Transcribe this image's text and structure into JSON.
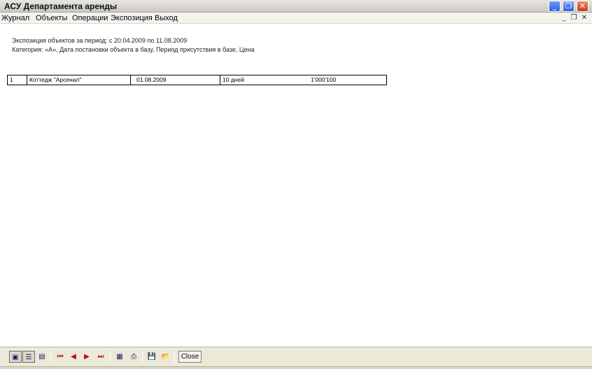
{
  "window": {
    "title": "АСУ Департамента аренды",
    "minimize_glyph": "_",
    "maximize_glyph": "❐",
    "close_glyph": "✕"
  },
  "menu": {
    "items": [
      "Журнал",
      "Объекты",
      "Операции",
      "Экспозиция",
      "Выход"
    ],
    "mdi_minimize": "_",
    "mdi_restore": "❐",
    "mdi_close": "✕"
  },
  "report": {
    "header_line1": "Экспозиция объектов за период: с 20.04.2009 по 11.08.2009",
    "header_line2": "Категория: «А», Дата постановки объекта в базу, Период присутствия в базе, Цена",
    "rows": [
      {
        "num": "1",
        "name": "Коттедж \"Арсенал\"",
        "date": "01.08.2009",
        "duration": "10 дней",
        "price": "1'000'100"
      }
    ]
  },
  "toolbar": {
    "icons": [
      "page-view-icon",
      "list-view-icon",
      "two-page-view-icon",
      "first-page-icon",
      "prev-page-icon",
      "next-page-icon",
      "last-page-icon",
      "print-setup-icon",
      "print-icon",
      "save-icon",
      "open-icon"
    ],
    "close_label": "Close"
  }
}
